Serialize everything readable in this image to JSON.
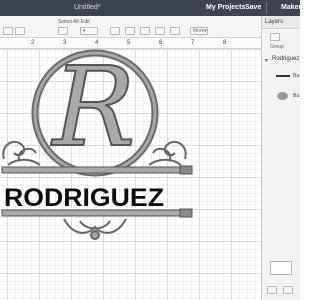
{
  "app": {
    "title": "Untitled*",
    "nav": [
      "My Projects",
      "Save",
      "Maker"
    ]
  },
  "toolbar": {
    "select_all": "Select All",
    "edit": "Edit",
    "more": "More"
  },
  "ruler": {
    "marks": [
      "2",
      "3",
      "4",
      "5",
      "6",
      "7",
      "8"
    ]
  },
  "design": {
    "monogram_letter": "R",
    "name": "RODRIGUEZ"
  },
  "panel": {
    "title": "Layers",
    "group_label": "Group",
    "layer_group_name": "Rodriguez",
    "layers": [
      {
        "name": "Ba"
      },
      {
        "name": "Ba"
      }
    ]
  }
}
